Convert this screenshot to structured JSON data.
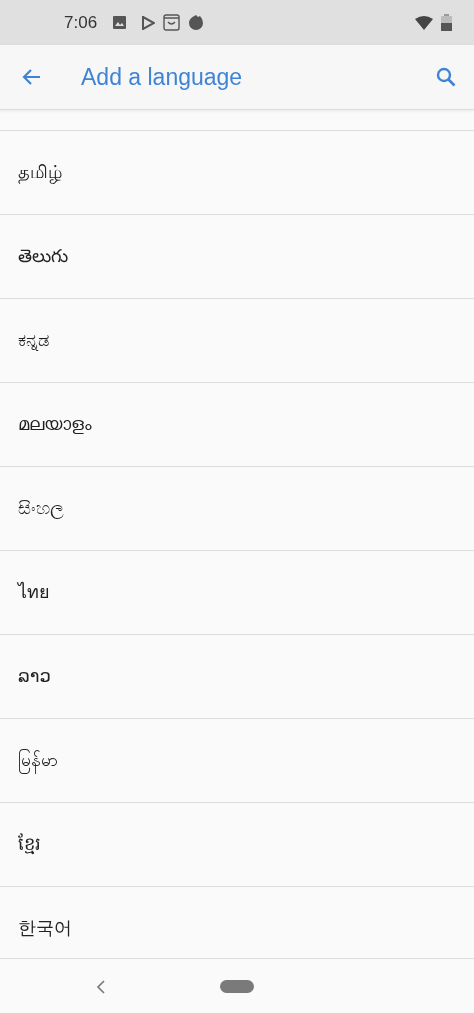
{
  "status_bar": {
    "time": "7:06"
  },
  "app_bar": {
    "title": "Add a language"
  },
  "languages": [
    {
      "label": "தமிழ்"
    },
    {
      "label": "తెలుగు"
    },
    {
      "label": "ಕನ್ನಡ"
    },
    {
      "label": "മലയാളം"
    },
    {
      "label": "සිංහල"
    },
    {
      "label": "ไทย"
    },
    {
      "label": "ລາວ"
    },
    {
      "label": "မြန်မာ"
    },
    {
      "label": "ខ្មែរ"
    },
    {
      "label": "한국어"
    }
  ]
}
